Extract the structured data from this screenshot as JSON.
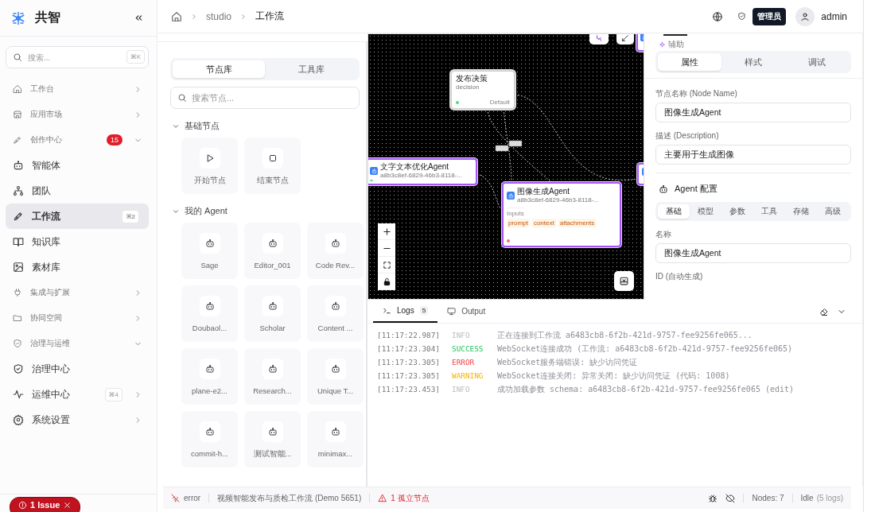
{
  "sidebar": {
    "brand": "共智",
    "search": {
      "placeholder": "搜索...",
      "shortcut": "⌘K"
    },
    "items": [
      {
        "label": "工作台",
        "kind": "section",
        "expanded": false
      },
      {
        "label": "应用市场",
        "kind": "section",
        "expanded": false
      },
      {
        "label": "创作中心",
        "kind": "section",
        "badge": "15",
        "expanded": true,
        "children": [
          {
            "label": "智能体",
            "selected": false
          },
          {
            "label": "团队",
            "selected": false
          },
          {
            "label": "工作流",
            "selected": true,
            "shortcut": "⌘2"
          },
          {
            "label": "知识库",
            "selected": false
          },
          {
            "label": "素材库",
            "selected": false
          }
        ]
      },
      {
        "label": "集成与扩展",
        "kind": "section",
        "expanded": false
      },
      {
        "label": "协同空间",
        "kind": "section",
        "expanded": false
      },
      {
        "label": "治理与运维",
        "kind": "section",
        "expanded": true,
        "children": [
          {
            "label": "治理中心",
            "selected": false
          },
          {
            "label": "运维中心",
            "selected": false,
            "shortcut": "⌘4",
            "expanded": false
          }
        ]
      },
      {
        "label": "系统设置",
        "kind": "link",
        "expanded": false
      }
    ],
    "issue_button": "1 Issue"
  },
  "header": {
    "breadcrumb": [
      "studio",
      "工作流"
    ],
    "role_badge": "管理员",
    "user": "admin"
  },
  "library": {
    "tabs": [
      {
        "label": "节点库",
        "selected": true
      },
      {
        "label": "工具库",
        "selected": false
      }
    ],
    "search": {
      "placeholder": "搜索节点..."
    },
    "sections": [
      {
        "title": "基础节点",
        "expanded": true,
        "items": [
          {
            "label": "开始节点",
            "kind": "start"
          },
          {
            "label": "结束节点",
            "kind": "end"
          }
        ]
      },
      {
        "title": "我的 Agent",
        "expanded": true,
        "items": [
          {
            "label": "Sage",
            "kind": "agent"
          },
          {
            "label": "Editor_001",
            "kind": "agent"
          },
          {
            "label": "Code Rev...",
            "kind": "agent"
          },
          {
            "label": "Doubaol...",
            "kind": "agent"
          },
          {
            "label": "Scholar",
            "kind": "agent"
          },
          {
            "label": "Content ...",
            "kind": "agent"
          },
          {
            "label": "plane-e2...",
            "kind": "agent"
          },
          {
            "label": "Research...",
            "kind": "agent"
          },
          {
            "label": "Unique T...",
            "kind": "agent"
          },
          {
            "label": "commit-h...",
            "kind": "agent"
          },
          {
            "label": "测试智能...",
            "kind": "agent"
          },
          {
            "label": "minimax...",
            "kind": "agent"
          }
        ]
      }
    ]
  },
  "canvas": {
    "nodes": [
      {
        "kind": "decision",
        "title": "发布决策",
        "subtitle": "decision",
        "port": "Default",
        "selected": false
      },
      {
        "kind": "agent",
        "title": "文字文本优化Agent",
        "subtitle": "a8b3c8ef-6829-46b3-8118-...",
        "selected": true
      },
      {
        "kind": "agent",
        "title": "图像生成Agent",
        "subtitle": "a8b3c8ef-6829-46b3-8118-...",
        "inputs_label": "Inputs",
        "inputs": [
          "prompt",
          "context",
          "attachments"
        ],
        "selected": true
      },
      {
        "kind": "stub",
        "selected": true
      },
      {
        "kind": "stub",
        "selected": true
      }
    ]
  },
  "properties": {
    "assist": "辅助",
    "tabs": [
      {
        "label": "属性",
        "selected": true
      },
      {
        "label": "样式",
        "selected": false
      },
      {
        "label": "调试",
        "selected": false
      }
    ],
    "fields": [
      {
        "label": "节点名称 (Node Name)",
        "value": "图像生成Agent"
      },
      {
        "label": "描述 (Description)",
        "value": "主要用于生成图像"
      }
    ],
    "agent_config": {
      "title": "Agent 配置",
      "tabs": [
        {
          "label": "基础",
          "selected": true
        },
        {
          "label": "模型",
          "selected": false
        },
        {
          "label": "参数",
          "selected": false
        },
        {
          "label": "工具",
          "selected": false
        },
        {
          "label": "存储",
          "selected": false
        },
        {
          "label": "高级",
          "selected": false
        }
      ],
      "fields": [
        {
          "label": "名称",
          "value": "图像生成Agent"
        },
        {
          "label": "ID (自动生成)"
        }
      ]
    }
  },
  "logs": {
    "tabs": [
      {
        "label": "Logs",
        "count": "5",
        "selected": true
      },
      {
        "label": "Output",
        "selected": false
      }
    ],
    "entries": [
      {
        "time": "[11:17:22.987]",
        "level": "INFO",
        "message": "正在连接到工作流 a6483cb8-6f2b-421d-9757-fee9256fe065..."
      },
      {
        "time": "[11:17:23.304]",
        "level": "SUCCESS",
        "message": "WebSocket连接成功 (工作流: a6483cb8-6f2b-421d-9757-fee9256fe065)"
      },
      {
        "time": "[11:17:23.305]",
        "level": "ERROR",
        "message": "WebSocket服务端错误: 缺少访问凭证"
      },
      {
        "time": "[11:17:23.305]",
        "level": "WARNING",
        "message": "WebSocket连接关闭: 异常关闭: 缺少访问凭证 (代码: 1008)"
      },
      {
        "time": "[11:17:23.453]",
        "level": "INFO",
        "message": "成功加载参数 schema: a6483cb8-6f2b-421d-9757-fee9256fe065 (edit)"
      }
    ]
  },
  "status_bar": {
    "connection": "error",
    "workflow": "视频智能发布与质检工作流 (Demo 5651)",
    "warning": "1 孤立节点",
    "nodes": "Nodes: 7",
    "state": "Idle",
    "log_count": "(5 logs)"
  }
}
